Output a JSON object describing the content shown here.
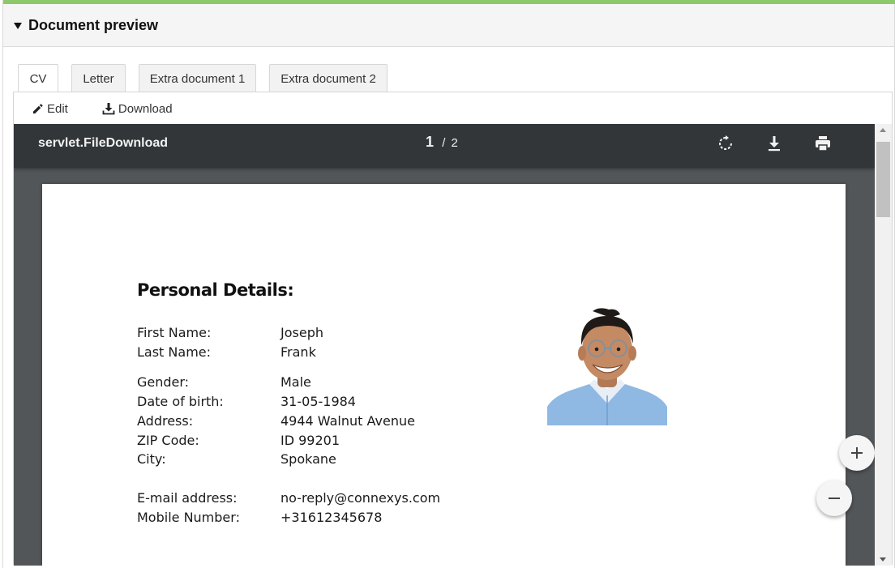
{
  "panel": {
    "title": "Document preview"
  },
  "tabs": [
    {
      "label": "CV",
      "active": true
    },
    {
      "label": "Letter",
      "active": false
    },
    {
      "label": "Extra document 1",
      "active": false
    },
    {
      "label": "Extra document 2",
      "active": false
    }
  ],
  "toolbar": {
    "edit_label": "Edit",
    "download_label": "Download"
  },
  "viewer": {
    "file_name": "servlet.FileDownload",
    "current_page": "1",
    "page_separator": "/",
    "total_pages": "2",
    "icons": [
      "rotate-icon",
      "download-icon",
      "print-icon"
    ]
  },
  "document": {
    "heading": "Personal Details:",
    "fields": [
      {
        "label": "First Name:",
        "value": "Joseph"
      },
      {
        "label": "Last Name:",
        "value": "Frank"
      },
      {
        "label": "Gender:",
        "value": "Male"
      },
      {
        "label": "Date of birth:",
        "value": "31-05-1984"
      },
      {
        "label": "Address:",
        "value": "4944 Walnut Avenue"
      },
      {
        "label": "ZIP Code:",
        "value": "ID 99201"
      },
      {
        "label": "City:",
        "value": "Spokane"
      },
      {
        "label": "E-mail address:",
        "value": "no-reply@connexys.com"
      },
      {
        "label": "Mobile Number:",
        "value": "+31612345678"
      }
    ]
  },
  "colors": {
    "accent_bar": "#8dc86a",
    "viewer_toolbar": "#323639",
    "viewer_background": "#525659"
  }
}
